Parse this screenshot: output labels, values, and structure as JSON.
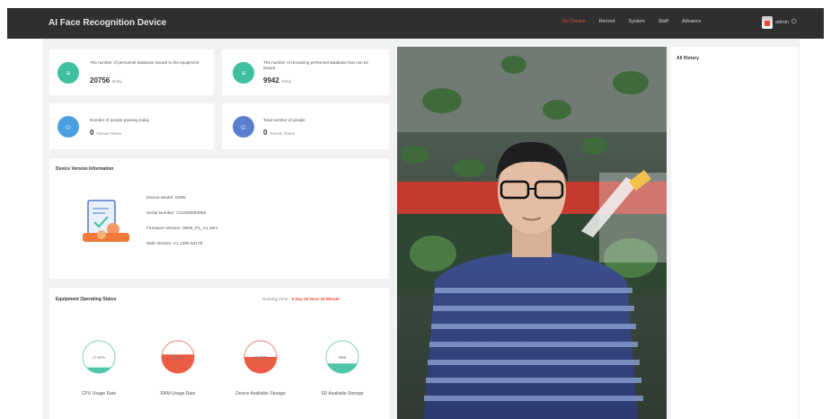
{
  "app": {
    "title": "AI Face Recognition Device"
  },
  "nav": {
    "items": [
      {
        "label": "Go Device",
        "active": true
      },
      {
        "label": "Record",
        "active": false
      },
      {
        "label": "System",
        "active": false
      },
      {
        "label": "Staff",
        "active": false
      },
      {
        "label": "Advance",
        "active": false
      }
    ],
    "user_name": "admin"
  },
  "stats": {
    "personnel_in_db": {
      "label": "The number of personnel database issued to the equipment",
      "value": "20756",
      "unit": "Entry"
    },
    "personnel_remaining": {
      "label": "The number of remaining personnel database that can be issued",
      "value": "9942",
      "unit": "Entry"
    },
    "people_today": {
      "label": "Number of people passing today",
      "value": "0",
      "unit": "Person Times"
    },
    "people_total": {
      "label": "Total number of people",
      "value": "0",
      "unit": "Person Times"
    }
  },
  "device_version": {
    "title": "Device Version Information",
    "rows": [
      "Device Model: K6R9",
      "Serial Number: C21000583669",
      "Firmware Version: 00R9_P1_A1.16r1",
      "Web Version: V1.1300.93178"
    ]
  },
  "equipment_status": {
    "title": "Equipment Operating Status",
    "running_time_label": "Running Time:",
    "running_time_value": "0 Day 00 Hour 18 Minute",
    "gauges": [
      {
        "label": "CPU Usage Rate",
        "text": "17.62%",
        "value": 17.62,
        "color": "#3dbfa0"
      },
      {
        "label": "RAM Usage Rate",
        "text": "57.62%",
        "value": 57.62,
        "color": "#e8492f"
      },
      {
        "label": "Device Available Storage",
        "text": "28.3MB",
        "value": 50,
        "color": "#e8492f"
      },
      {
        "label": "SD Available Storage",
        "text": "0MB",
        "value": 30,
        "color": "#3dbfa0"
      }
    ]
  },
  "history": {
    "title": "All History"
  },
  "colors": {
    "accent": "#e8492f",
    "teal": "#3dbfa0",
    "blue": "#4b9fe0",
    "indigo": "#5a7fd0"
  }
}
